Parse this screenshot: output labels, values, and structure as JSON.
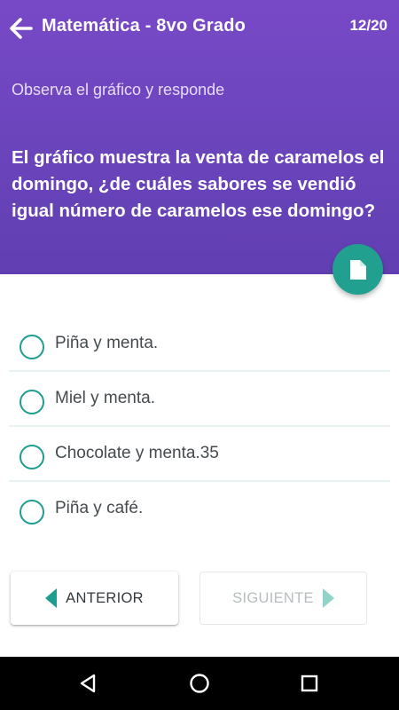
{
  "header": {
    "title": "Matemática - 8vo Grado",
    "counter": "12/20",
    "back_icon": "arrow-left-icon",
    "background_color": "#6a44bb"
  },
  "instruction": "Observa el gráfico y responde",
  "question": "El gráfico muestra la venta de caramelos el domingo, ¿de cuáles sabores se vendió igual número de caramelos ese domingo?",
  "fab": {
    "icon": "document-icon",
    "color": "#21a090"
  },
  "options": [
    {
      "label": "Piña y menta."
    },
    {
      "label": "Miel y menta."
    },
    {
      "label": "Chocolate y menta.35"
    },
    {
      "label": "Piña y café."
    }
  ],
  "buttons": {
    "previous": "ANTERIOR",
    "next": "SIGUIENTE"
  },
  "navbar": {
    "back_icon": "triangle-back-icon",
    "home_icon": "circle-home-icon",
    "recents_icon": "square-recents-icon"
  },
  "colors": {
    "accent": "#1f9d8f",
    "header": "#6a44bb"
  }
}
